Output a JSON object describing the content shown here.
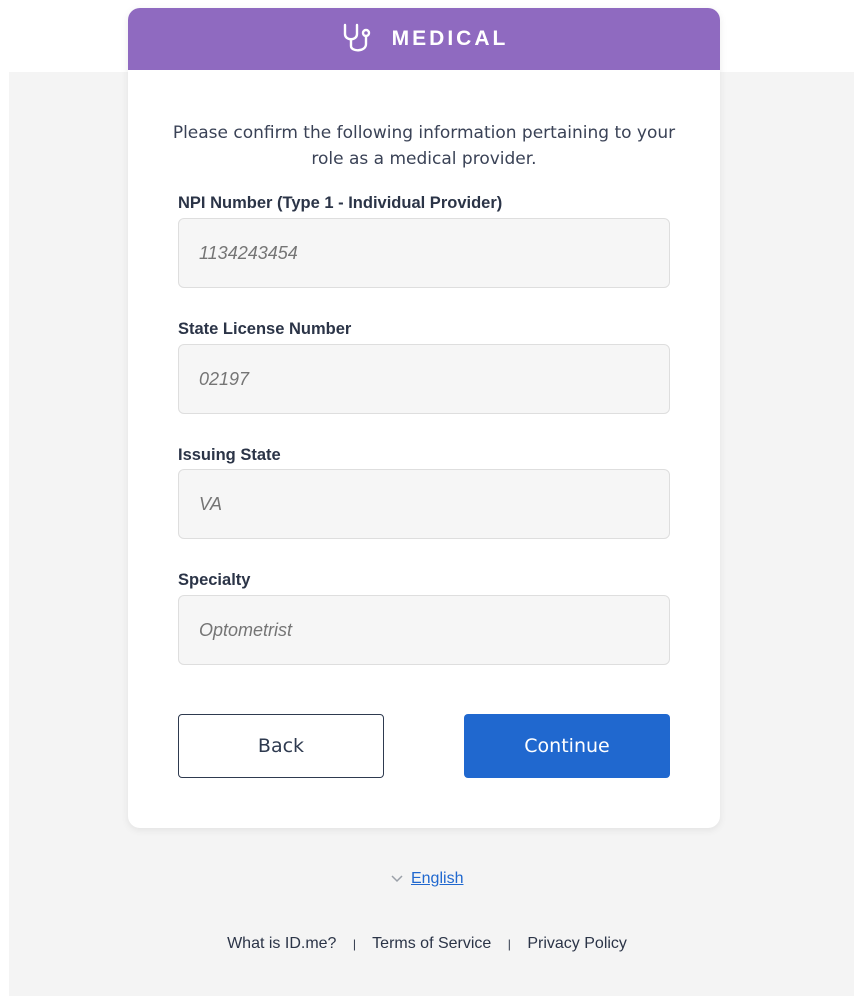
{
  "header": {
    "title": "MEDICAL",
    "icon": "stethoscope-icon",
    "color": "#8f6ac0"
  },
  "intro": "Please confirm the following information pertaining to your role as a medical provider.",
  "fields": [
    {
      "label": "NPI Number (Type 1 - Individual Provider)",
      "placeholder": "1134243454"
    },
    {
      "label": "State License Number",
      "placeholder": "02197"
    },
    {
      "label": "Issuing State",
      "placeholder": "VA"
    },
    {
      "label": "Specialty",
      "placeholder": "Optometrist"
    }
  ],
  "buttons": {
    "back": "Back",
    "continue": "Continue",
    "continue_color": "#2068cf"
  },
  "language": {
    "chevron_icon": "chevron-down-icon",
    "label": "English"
  },
  "footer": {
    "links": [
      "What is ID.me?",
      "Terms of Service",
      "Privacy Policy"
    ],
    "separator": "|"
  }
}
